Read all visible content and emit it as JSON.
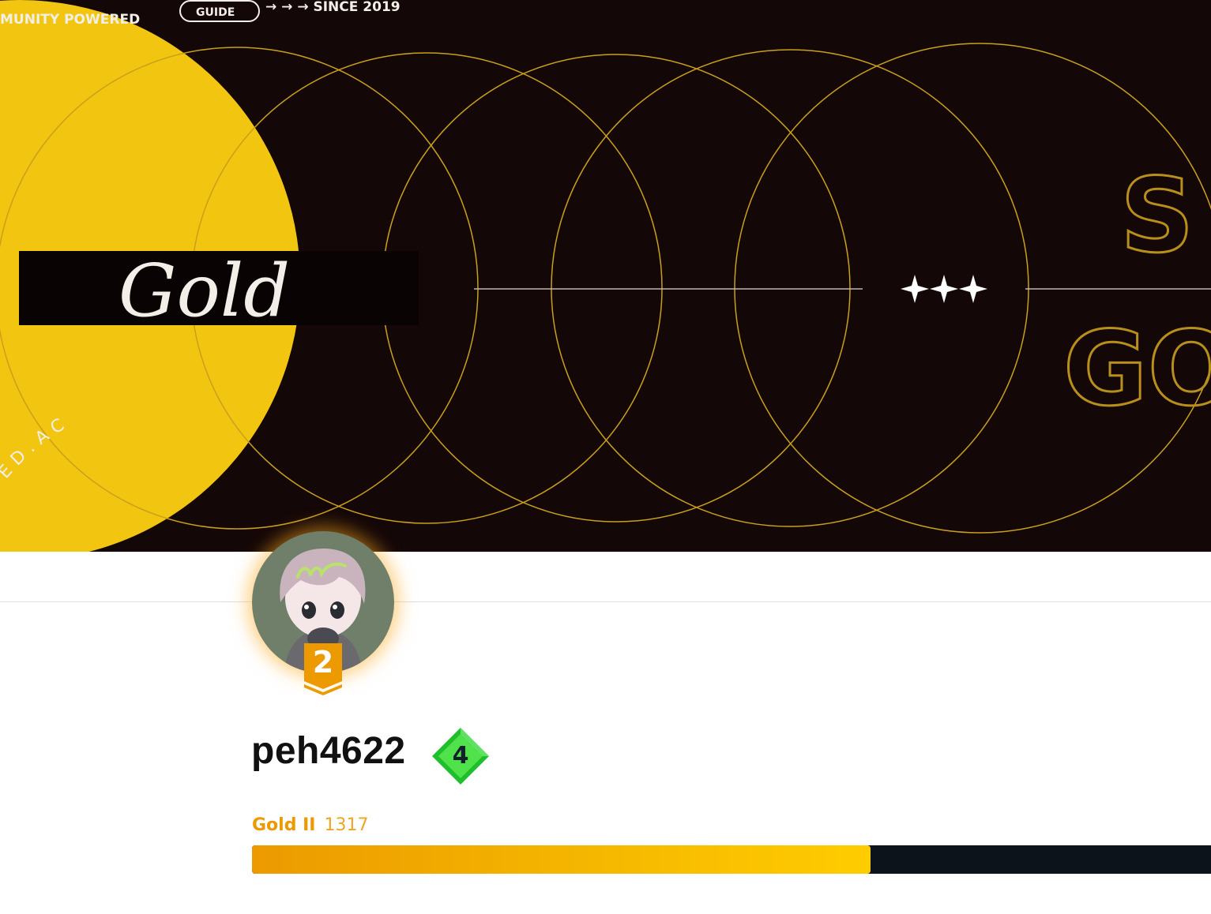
{
  "banner": {
    "top_text_left": "MUNITY POWERED",
    "top_text_guide": "GUIDE",
    "top_text_since": "→ → → SINCE 2019",
    "circle_text": "WO · SOLVED.AC",
    "script_word": "Gold",
    "sparkles": "✦✦✦",
    "outline_letters_top": "S",
    "outline_letters_bottom": "GO",
    "yellow": "#f2c511",
    "dark": "#140707",
    "line_gold": "#c9a01a"
  },
  "profile": {
    "username": "peh4622",
    "avatar_icon": "anime-avatar-icon",
    "rank_badge": {
      "number": "2",
      "color": "#ec9a00"
    },
    "class_badge": {
      "number": "4",
      "color": "#22c55e"
    },
    "tier_name": "Gold II",
    "rating": "1317",
    "tier_color": "#ec9a00",
    "progress_fraction": 0.645
  }
}
